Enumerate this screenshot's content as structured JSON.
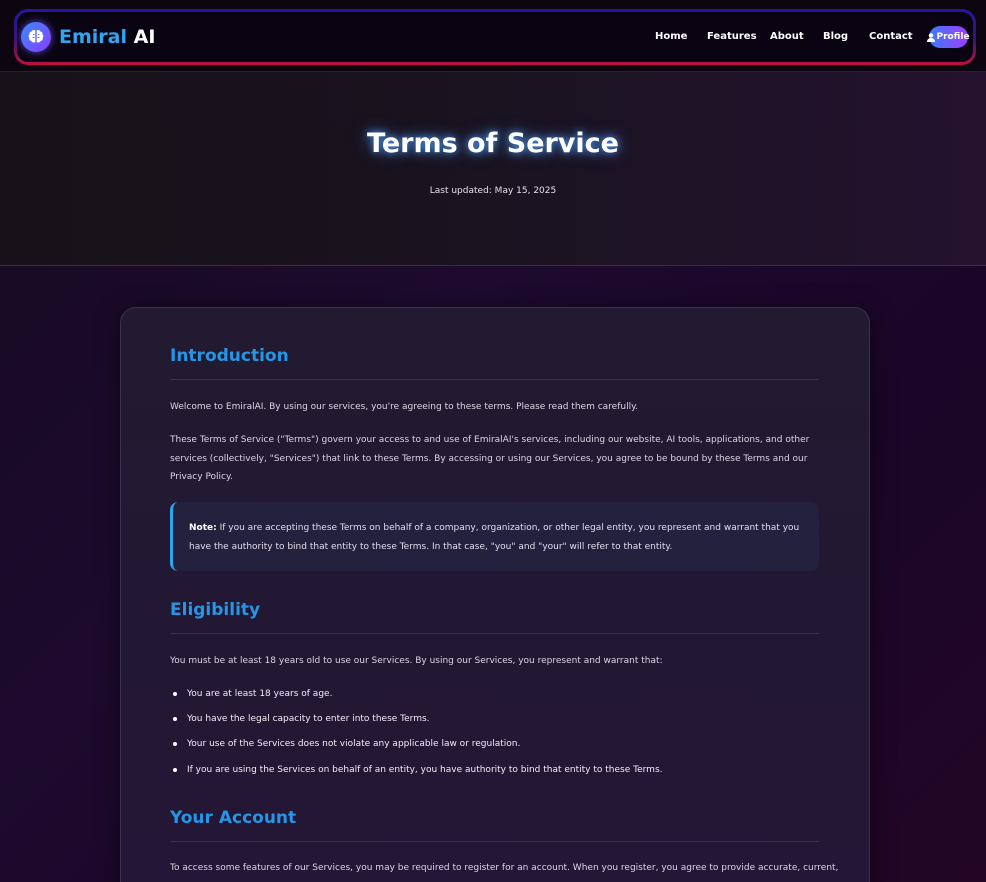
{
  "brand": {
    "part1": "Emiral",
    "part2": "AI"
  },
  "nav": {
    "home": "Home",
    "features": "Features",
    "about": "About",
    "blog": "Blog",
    "contact": "Contact",
    "profile": "Profile"
  },
  "hero": {
    "title": "Terms of Service",
    "updated": "Last updated: May 15, 2025"
  },
  "content": {
    "intro_heading": "Introduction",
    "intro_p1": "Welcome to EmiralAI. By using our services, you're agreeing to these terms. Please read them carefully.",
    "intro_p2": "These Terms of Service (\"Terms\") govern your access to and use of EmiralAI's services, including our website, AI tools, applications, and other services (collectively, \"Services\") that link to these Terms. By accessing or using our Services, you agree to be bound by these Terms and our Privacy Policy.",
    "note_label": "Note:",
    "note_text": " If you are accepting these Terms on behalf of a company, organization, or other legal entity, you represent and warrant that you have the authority to bind that entity to these Terms. In that case, \"you\" and \"your\" will refer to that entity.",
    "eligibility_heading": "Eligibility",
    "eligibility_p": "You must be at least 18 years old to use our Services. By using our Services, you represent and warrant that:",
    "eligibility_items": [
      "You are at least 18 years of age.",
      "You have the legal capacity to enter into these Terms.",
      "Your use of the Services does not violate any applicable law or regulation.",
      "If you are using the Services on behalf of an entity, you have authority to bind that entity to these Terms."
    ],
    "account_heading": "Your Account",
    "account_p": "To access some features of our Services, you may be required to register for an account. When you register, you agree to provide accurate, current,"
  },
  "colors": {
    "accent_blue": "#2596e6",
    "brand_blue": "#2ea6f2",
    "note_border": "#2aa7f0"
  },
  "icons": {
    "logo": "brain-icon",
    "profile": "user-icon"
  }
}
